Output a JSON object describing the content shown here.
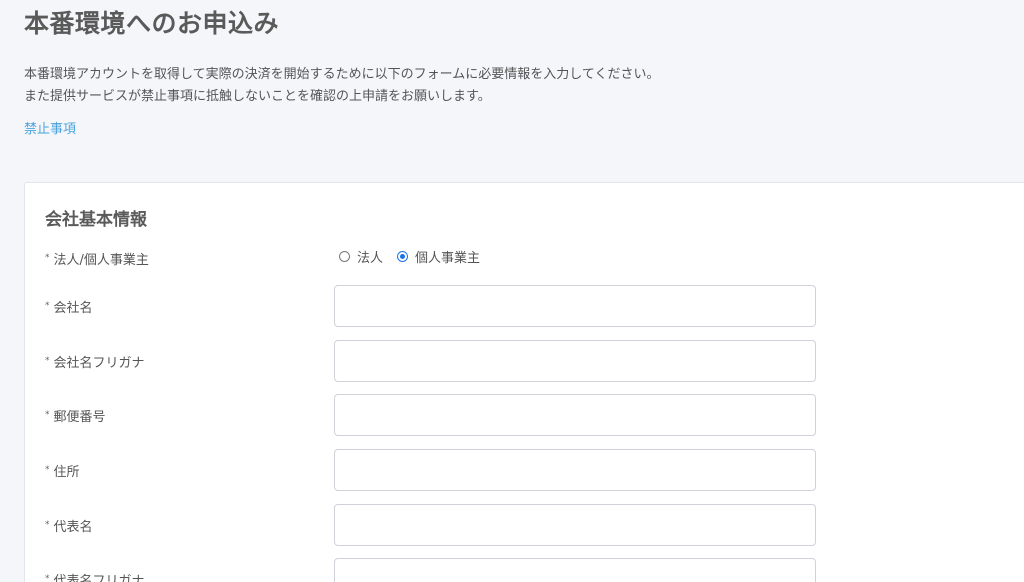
{
  "header": {
    "title": "本番環境へのお申込み",
    "intro_line1": "本番環境アカウントを取得して実際の決済を開始するために以下のフォームに必要情報を入力してください。",
    "intro_line2": "また提供サービスが禁止事項に抵触しないことを確認の上申請をお願いします。",
    "prohibited_link": "禁止事項"
  },
  "form": {
    "section_title": "会社基本情報",
    "required_mark": "*",
    "entity_type": {
      "label": "法人/個人事業主",
      "options": [
        "法人",
        "個人事業主"
      ],
      "selected": "個人事業主"
    },
    "fields": [
      {
        "label": "会社名",
        "value": "",
        "placeholder": ""
      },
      {
        "label": "会社名フリガナ",
        "value": "",
        "placeholder": ""
      },
      {
        "label": "郵便番号",
        "value": "",
        "placeholder": ""
      },
      {
        "label": "住所",
        "value": "",
        "placeholder": ""
      },
      {
        "label": "代表名",
        "value": "",
        "placeholder": ""
      },
      {
        "label": "代表名フリガナ",
        "value": "",
        "placeholder": ""
      }
    ]
  },
  "colors": {
    "background": "#f5f6fa",
    "card": "#ffffff",
    "link": "#4aa3df",
    "radio_accent": "#1a73e8"
  }
}
